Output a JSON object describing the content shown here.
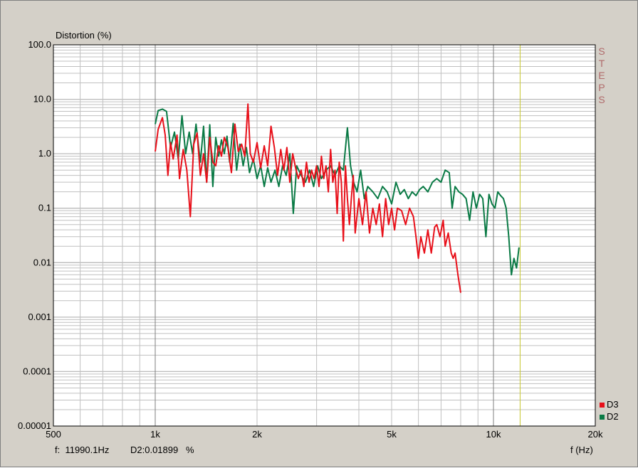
{
  "chart_data": {
    "type": "line",
    "ylabel": "Distortion (%)",
    "xlabel": "f (Hz)",
    "x_scale": "log",
    "y_scale": "log",
    "xlim": [
      500,
      20000
    ],
    "ylim": [
      1e-05,
      100
    ],
    "x_ticks": [
      {
        "value": 500,
        "label": "500"
      },
      {
        "value": 1000,
        "label": "1k"
      },
      {
        "value": 2000,
        "label": "2k"
      },
      {
        "value": 5000,
        "label": "5k"
      },
      {
        "value": 10000,
        "label": "10k"
      },
      {
        "value": 20000,
        "label": "20k"
      }
    ],
    "y_ticks": [
      {
        "value": 100,
        "label": "100.0"
      },
      {
        "value": 10,
        "label": "10.0"
      },
      {
        "value": 1,
        "label": "1.0"
      },
      {
        "value": 0.1,
        "label": "0.1"
      },
      {
        "value": 0.01,
        "label": "0.01"
      },
      {
        "value": 0.001,
        "label": "0.001"
      },
      {
        "value": 0.0001,
        "label": "0.0001"
      },
      {
        "value": 1e-05,
        "label": "0.00001"
      }
    ],
    "grid": true,
    "legend_position": "bottom-right",
    "cursor_frequency": 11990.1,
    "series": [
      {
        "name": "D3",
        "color": "#e8101a",
        "points": [
          [
            1000,
            1.1
          ],
          [
            1020,
            2.8
          ],
          [
            1050,
            4.6
          ],
          [
            1070,
            2.2
          ],
          [
            1090,
            0.4
          ],
          [
            1110,
            1.6
          ],
          [
            1130,
            0.8
          ],
          [
            1160,
            2.2
          ],
          [
            1180,
            0.35
          ],
          [
            1210,
            1.2
          ],
          [
            1240,
            0.5
          ],
          [
            1270,
            0.07
          ],
          [
            1300,
            1.5
          ],
          [
            1330,
            2.4
          ],
          [
            1360,
            0.4
          ],
          [
            1390,
            1.0
          ],
          [
            1420,
            0.3
          ],
          [
            1450,
            2.0
          ],
          [
            1480,
            0.7
          ],
          [
            1510,
            0.6
          ],
          [
            1540,
            1.4
          ],
          [
            1570,
            0.9
          ],
          [
            1600,
            2.0
          ],
          [
            1640,
            1.3
          ],
          [
            1680,
            0.45
          ],
          [
            1720,
            3.5
          ],
          [
            1760,
            1.1
          ],
          [
            1800,
            1.5
          ],
          [
            1840,
            0.9
          ],
          [
            1880,
            8.2
          ],
          [
            1910,
            1.0
          ],
          [
            1950,
            0.7
          ],
          [
            2000,
            1.6
          ],
          [
            2050,
            0.55
          ],
          [
            2100,
            1.4
          ],
          [
            2150,
            0.6
          ],
          [
            2200,
            3.2
          ],
          [
            2250,
            1.3
          ],
          [
            2300,
            0.4
          ],
          [
            2350,
            1.2
          ],
          [
            2400,
            0.5
          ],
          [
            2450,
            1.3
          ],
          [
            2500,
            0.3
          ],
          [
            2550,
            1.0
          ],
          [
            2600,
            0.55
          ],
          [
            2650,
            0.35
          ],
          [
            2700,
            0.5
          ],
          [
            2750,
            0.25
          ],
          [
            2800,
            0.7
          ],
          [
            2850,
            0.3
          ],
          [
            2900,
            0.5
          ],
          [
            2950,
            0.35
          ],
          [
            3000,
            0.6
          ],
          [
            3050,
            0.25
          ],
          [
            3100,
            0.9
          ],
          [
            3150,
            0.35
          ],
          [
            3200,
            0.6
          ],
          [
            3250,
            0.2
          ],
          [
            3300,
            1.2
          ],
          [
            3350,
            0.3
          ],
          [
            3400,
            0.5
          ],
          [
            3450,
            0.08
          ],
          [
            3500,
            0.7
          ],
          [
            3550,
            0.3
          ],
          [
            3600,
            0.025
          ],
          [
            3650,
            0.6
          ],
          [
            3700,
            0.15
          ],
          [
            3750,
            0.05
          ],
          [
            3800,
            0.15
          ],
          [
            3850,
            0.4
          ],
          [
            3900,
            0.035
          ],
          [
            4000,
            0.15
          ],
          [
            4100,
            0.05
          ],
          [
            4200,
            0.2
          ],
          [
            4300,
            0.035
          ],
          [
            4400,
            0.1
          ],
          [
            4500,
            0.05
          ],
          [
            4600,
            0.12
          ],
          [
            4700,
            0.03
          ],
          [
            4800,
            0.15
          ],
          [
            4900,
            0.05
          ],
          [
            5000,
            0.1
          ],
          [
            5100,
            0.04
          ],
          [
            5200,
            0.1
          ],
          [
            5350,
            0.09
          ],
          [
            5500,
            0.05
          ],
          [
            5650,
            0.1
          ],
          [
            5800,
            0.07
          ],
          [
            5900,
            0.03
          ],
          [
            6000,
            0.012
          ],
          [
            6100,
            0.03
          ],
          [
            6250,
            0.015
          ],
          [
            6400,
            0.04
          ],
          [
            6550,
            0.015
          ],
          [
            6700,
            0.045
          ],
          [
            6800,
            0.05
          ],
          [
            6950,
            0.03
          ],
          [
            7100,
            0.06
          ],
          [
            7200,
            0.02
          ],
          [
            7350,
            0.035
          ],
          [
            7500,
            0.015
          ],
          [
            7600,
            0.012
          ],
          [
            7700,
            0.015
          ],
          [
            7850,
            0.006
          ],
          [
            8000,
            0.0028
          ]
        ]
      },
      {
        "name": "D2",
        "color": "#0a7a45",
        "points": [
          [
            1000,
            3.5
          ],
          [
            1020,
            6.2
          ],
          [
            1050,
            6.6
          ],
          [
            1080,
            6.0
          ],
          [
            1110,
            1.3
          ],
          [
            1140,
            2.5
          ],
          [
            1170,
            0.8
          ],
          [
            1200,
            5.0
          ],
          [
            1230,
            1.0
          ],
          [
            1260,
            2.5
          ],
          [
            1290,
            1.0
          ],
          [
            1320,
            3.5
          ],
          [
            1360,
            0.7
          ],
          [
            1390,
            3.2
          ],
          [
            1420,
            0.3
          ],
          [
            1450,
            3.4
          ],
          [
            1480,
            0.25
          ],
          [
            1510,
            2.0
          ],
          [
            1540,
            0.9
          ],
          [
            1570,
            1.8
          ],
          [
            1600,
            1.0
          ],
          [
            1630,
            2.1
          ],
          [
            1660,
            0.7
          ],
          [
            1700,
            3.6
          ],
          [
            1740,
            0.5
          ],
          [
            1780,
            1.5
          ],
          [
            1820,
            0.6
          ],
          [
            1860,
            1.3
          ],
          [
            1900,
            0.45
          ],
          [
            1950,
            0.8
          ],
          [
            2000,
            0.35
          ],
          [
            2050,
            0.6
          ],
          [
            2100,
            0.25
          ],
          [
            2150,
            0.55
          ],
          [
            2200,
            0.3
          ],
          [
            2260,
            0.5
          ],
          [
            2320,
            0.25
          ],
          [
            2380,
            0.6
          ],
          [
            2440,
            0.4
          ],
          [
            2500,
            1.0
          ],
          [
            2560,
            0.08
          ],
          [
            2620,
            0.6
          ],
          [
            2700,
            0.4
          ],
          [
            2780,
            0.3
          ],
          [
            2860,
            0.5
          ],
          [
            2940,
            0.25
          ],
          [
            3020,
            0.6
          ],
          [
            3100,
            0.35
          ],
          [
            3200,
            0.5
          ],
          [
            3300,
            0.6
          ],
          [
            3400,
            0.4
          ],
          [
            3500,
            0.6
          ],
          [
            3600,
            0.5
          ],
          [
            3700,
            3.0
          ],
          [
            3780,
            0.6
          ],
          [
            3860,
            0.3
          ],
          [
            3950,
            0.2
          ],
          [
            4050,
            0.5
          ],
          [
            4150,
            0.15
          ],
          [
            4250,
            0.25
          ],
          [
            4400,
            0.2
          ],
          [
            4550,
            0.15
          ],
          [
            4700,
            0.25
          ],
          [
            4850,
            0.2
          ],
          [
            5000,
            0.12
          ],
          [
            5150,
            0.3
          ],
          [
            5300,
            0.18
          ],
          [
            5450,
            0.22
          ],
          [
            5600,
            0.15
          ],
          [
            5750,
            0.2
          ],
          [
            5900,
            0.17
          ],
          [
            6050,
            0.22
          ],
          [
            6200,
            0.25
          ],
          [
            6400,
            0.2
          ],
          [
            6600,
            0.3
          ],
          [
            6800,
            0.35
          ],
          [
            7000,
            0.3
          ],
          [
            7200,
            0.5
          ],
          [
            7400,
            0.45
          ],
          [
            7550,
            0.1
          ],
          [
            7700,
            0.25
          ],
          [
            7900,
            0.2
          ],
          [
            8100,
            0.18
          ],
          [
            8300,
            0.15
          ],
          [
            8500,
            0.06
          ],
          [
            8700,
            0.2
          ],
          [
            8900,
            0.1
          ],
          [
            9100,
            0.18
          ],
          [
            9300,
            0.15
          ],
          [
            9500,
            0.03
          ],
          [
            9700,
            0.18
          ],
          [
            9900,
            0.12
          ],
          [
            10100,
            0.1
          ],
          [
            10300,
            0.2
          ],
          [
            10500,
            0.17
          ],
          [
            10700,
            0.15
          ],
          [
            10900,
            0.1
          ],
          [
            11100,
            0.03
          ],
          [
            11300,
            0.006
          ],
          [
            11500,
            0.012
          ],
          [
            11700,
            0.008
          ],
          [
            11900,
            0.019
          ]
        ]
      }
    ]
  },
  "side_label": "STEPS",
  "readout": {
    "freq_text": "f:  11990.1Hz",
    "value_text": "D2:0.01899   %"
  },
  "legend": [
    {
      "name": "D3",
      "color": "#e8101a"
    },
    {
      "name": "D2",
      "color": "#0a7a45"
    }
  ],
  "cursor_color": "#c8c830",
  "grid_color": "#c0c0c0",
  "plot_bg": "#ffffff"
}
